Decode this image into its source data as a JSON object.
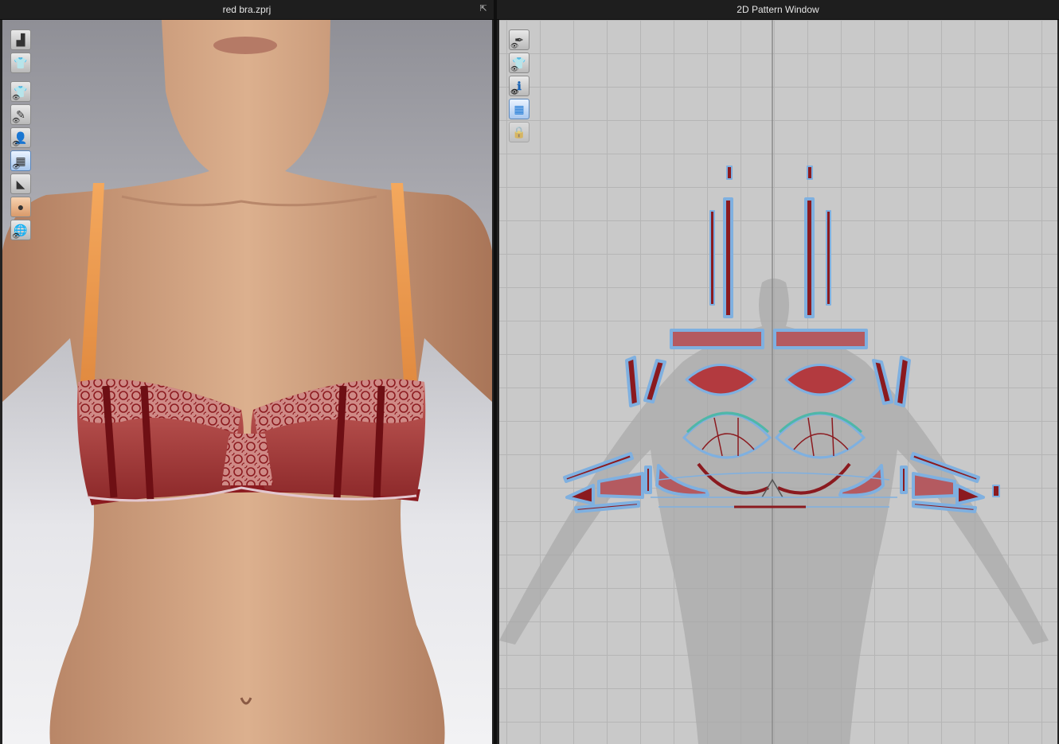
{
  "left_window": {
    "title": "red bra.zprj",
    "popout_icon": "popout-icon",
    "toolbar": [
      {
        "icon": "avatar-shoe-icon",
        "glyph": "▟"
      },
      {
        "icon": "garment-shirt-icon",
        "glyph": "👕"
      },
      {
        "icon": "show-garment-icon",
        "glyph": "👕",
        "eye": true
      },
      {
        "icon": "show-pattern-brush-icon",
        "glyph": "✎",
        "eye": true
      },
      {
        "icon": "show-avatar-icon",
        "glyph": "👤",
        "eye": true
      },
      {
        "icon": "texture-display-icon",
        "glyph": "▦",
        "eye": true
      },
      {
        "icon": "shoe-display-icon",
        "glyph": "◣"
      },
      {
        "icon": "avatar-skin-icon",
        "glyph": "●"
      },
      {
        "icon": "globe-display-icon",
        "glyph": "🌐",
        "eye": true
      }
    ]
  },
  "right_window": {
    "title": "2D Pattern Window",
    "toolbar": [
      {
        "icon": "pattern-pen-icon",
        "glyph": "✒",
        "eye": true
      },
      {
        "icon": "show-pattern-shirt-icon",
        "glyph": "👕",
        "eye": true
      },
      {
        "icon": "info-icon",
        "glyph": "ℹ",
        "eye": true
      },
      {
        "icon": "texture-display-icon",
        "glyph": "▦"
      },
      {
        "icon": "locked-pattern-icon",
        "glyph": "🔒"
      }
    ]
  },
  "colors": {
    "fabric": "#8b1a1f",
    "lace": "#c4505a",
    "strap": "#ee9c52",
    "skin": "#d7a886",
    "pattern_outline": "#7fb0e0"
  }
}
